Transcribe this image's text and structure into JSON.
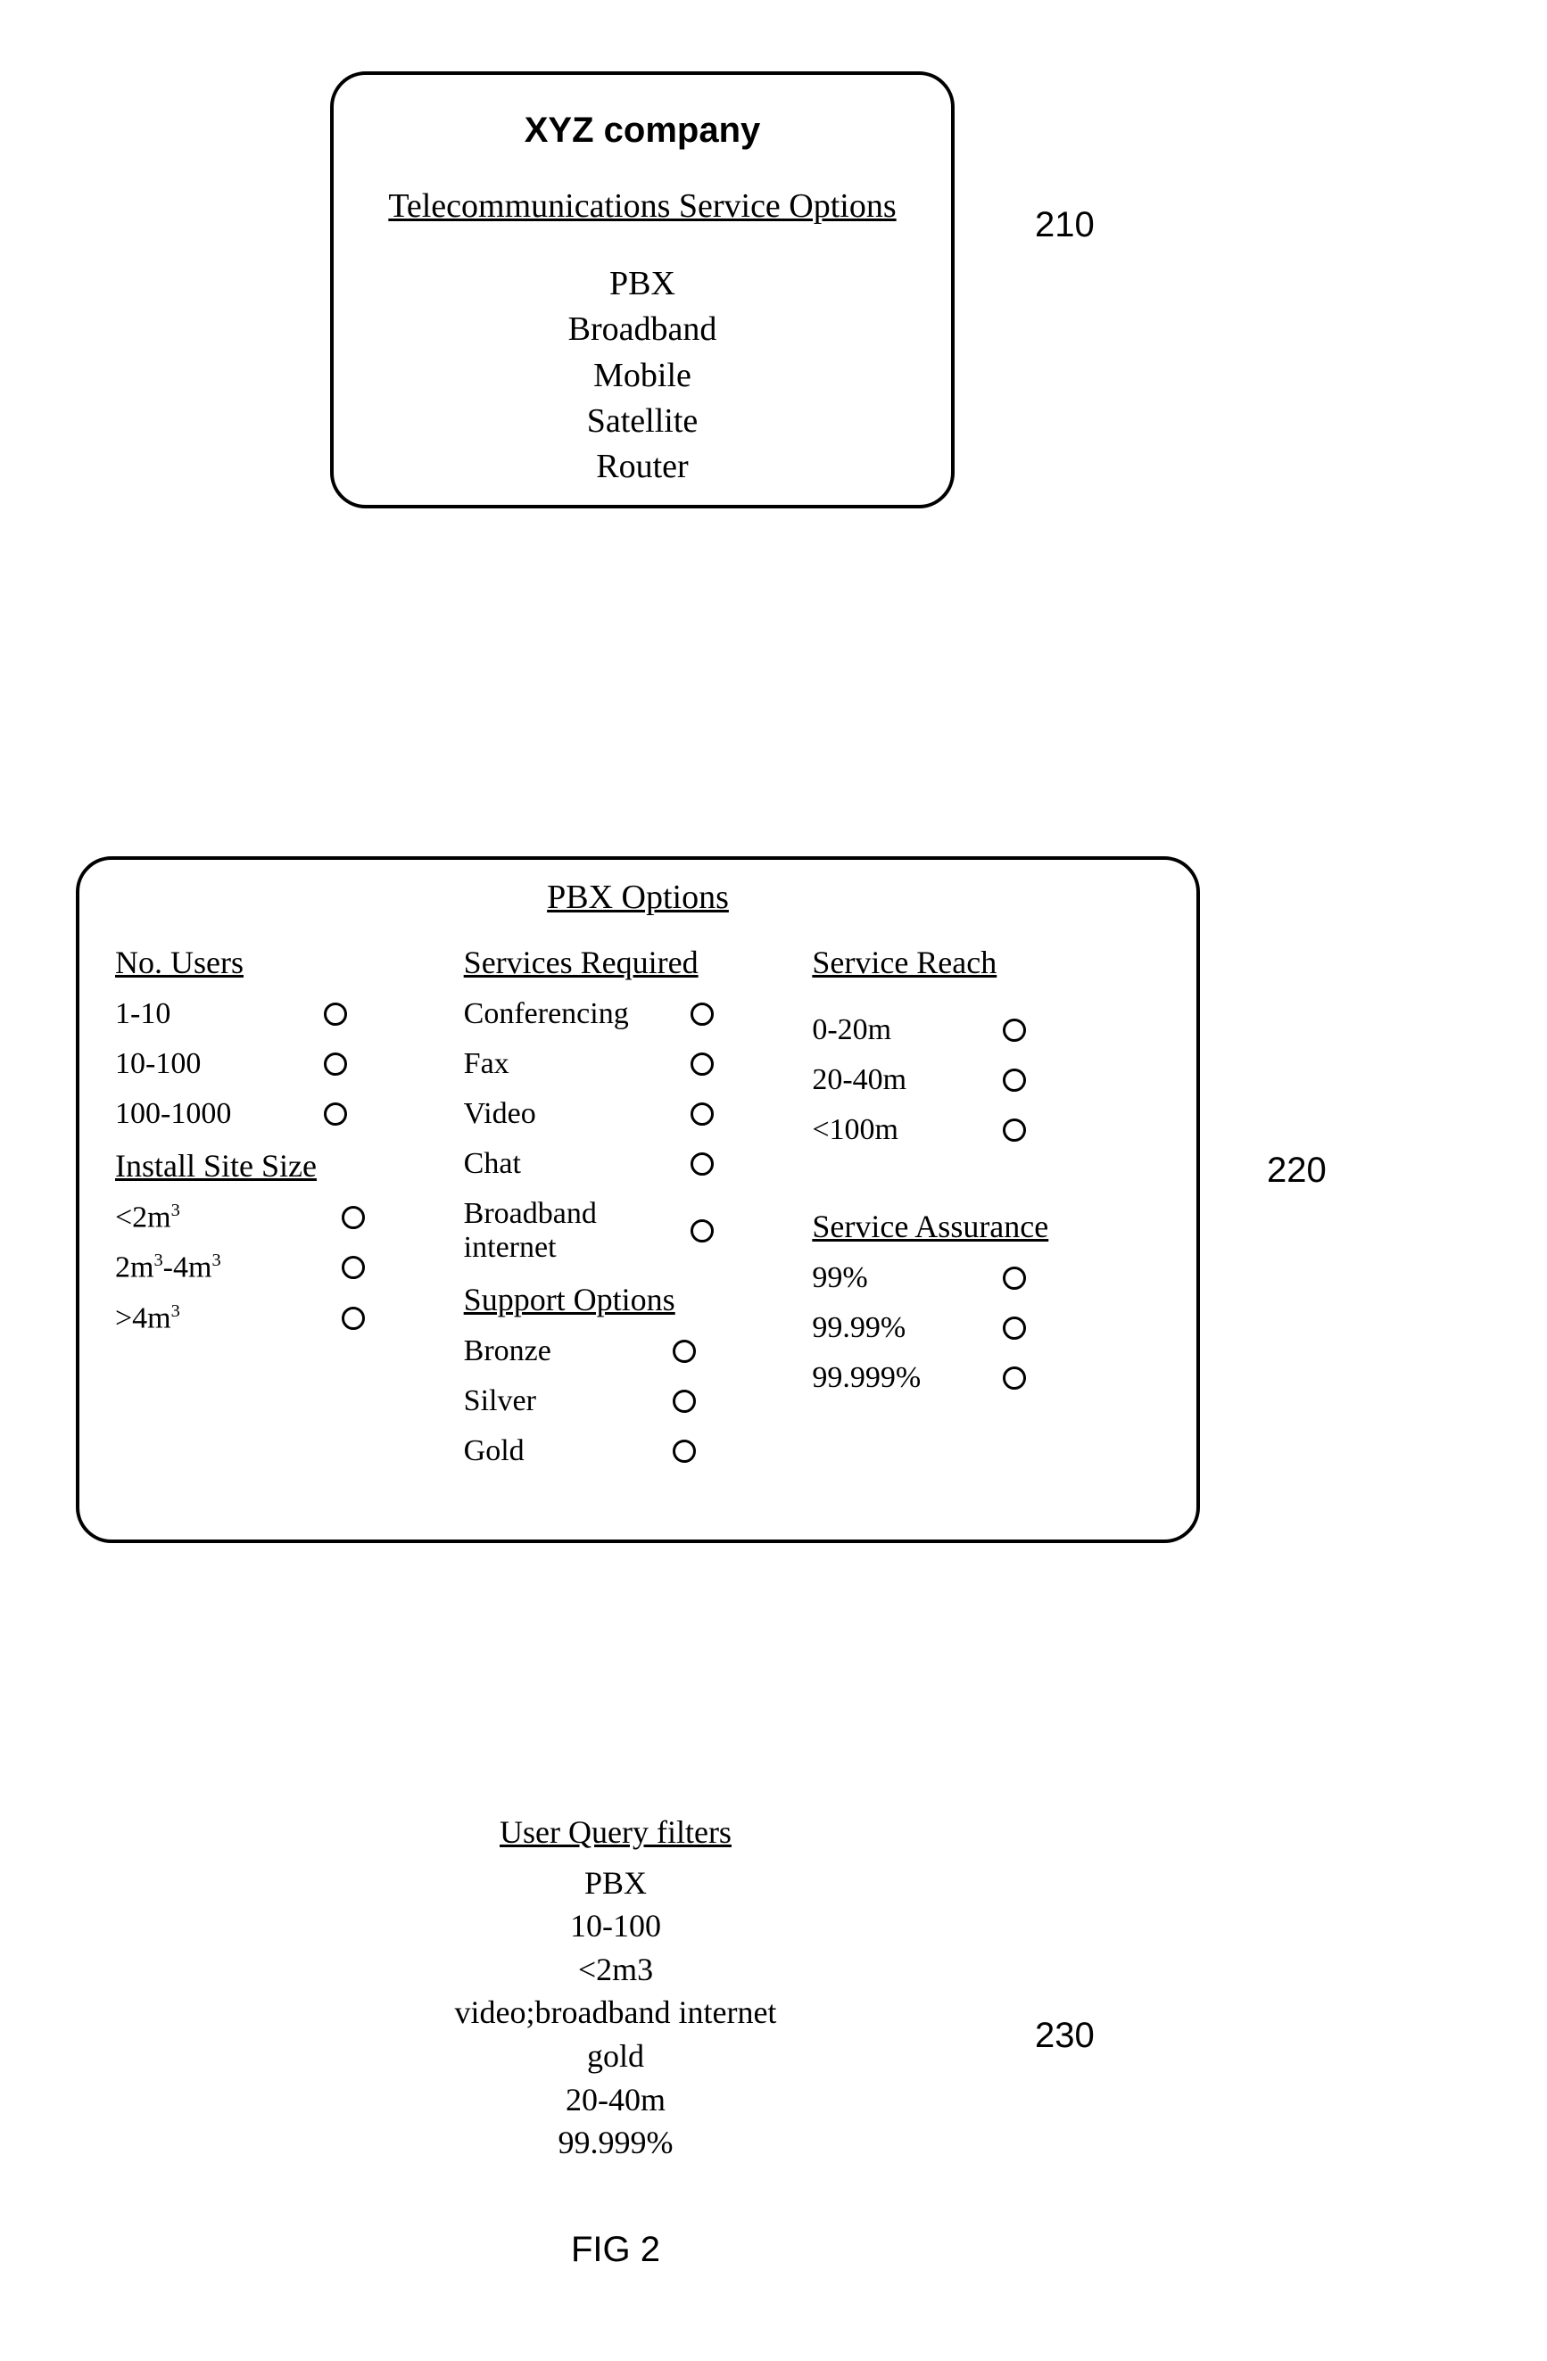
{
  "box210": {
    "company": "XYZ company",
    "subtitle": "Telecommunications Service Options",
    "services": [
      "PBX",
      "Broadband",
      "Mobile",
      "Satellite",
      "Router"
    ]
  },
  "labels": {
    "l210": "210",
    "l220": "220",
    "l230": "230",
    "fig": "FIG 2"
  },
  "box220": {
    "title": "PBX Options",
    "groups": {
      "users": {
        "title": "No. Users",
        "options": [
          "1-10",
          "10-100",
          "100-1000"
        ]
      },
      "site": {
        "title": "Install Site Size",
        "options_html": [
          "<2m<sup>3</sup>",
          "2m<sup>3</sup>-4m<sup>3</sup>",
          ">4m<sup>3</sup>"
        ]
      },
      "services": {
        "title": "Services Required",
        "options": [
          "Conferencing",
          "Fax",
          "Video",
          "Chat",
          "Broadband internet"
        ]
      },
      "support": {
        "title": "Support Options",
        "options": [
          "Bronze",
          "Silver",
          "Gold"
        ]
      },
      "reach": {
        "title": "Service Reach",
        "options": [
          "0-20m",
          "20-40m",
          "<100m"
        ]
      },
      "assurance": {
        "title": "Service Assurance",
        "options": [
          "99%",
          "99.99%",
          "99.999%"
        ]
      }
    }
  },
  "query": {
    "title": "User Query filters",
    "lines": [
      "PBX",
      "10-100",
      "<2m3",
      "video;broadband internet",
      "gold",
      "20-40m",
      "99.999%"
    ]
  }
}
